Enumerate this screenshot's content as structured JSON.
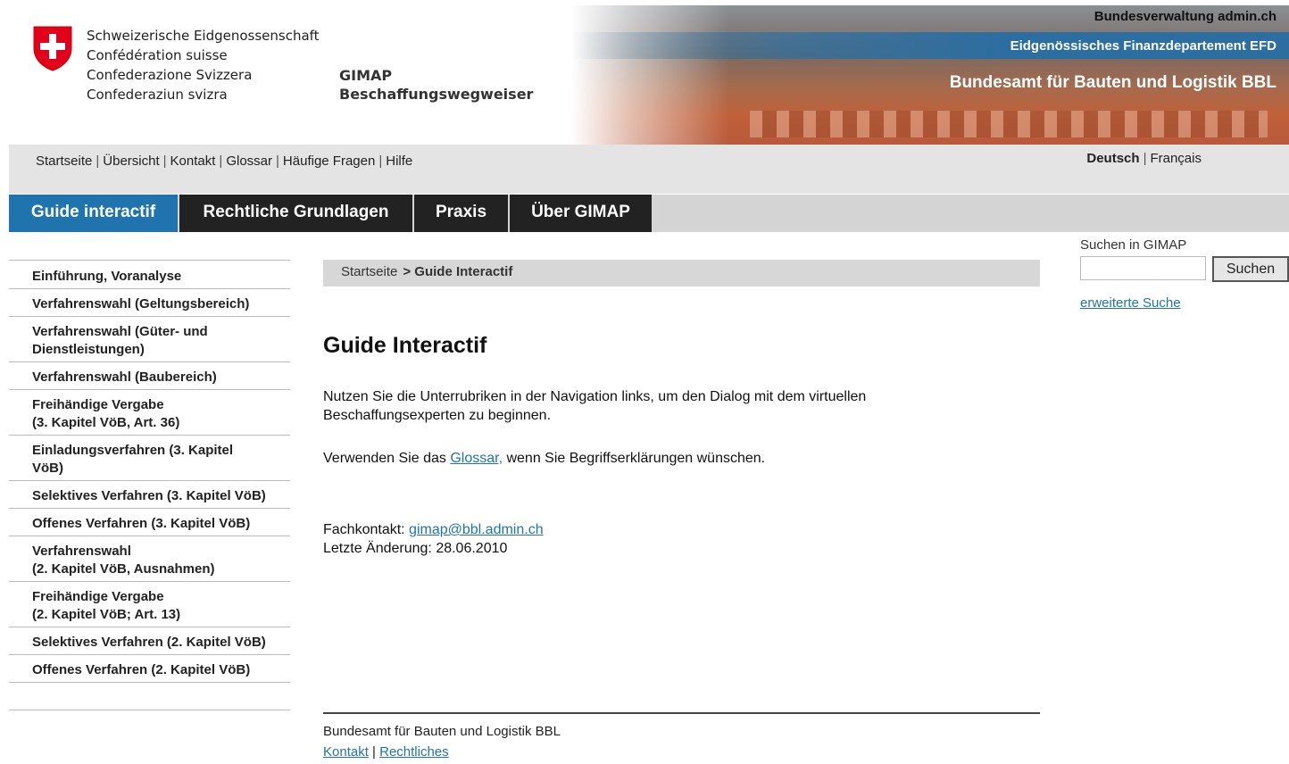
{
  "header": {
    "confederation_lines": [
      "Schweizerische Eidgenossenschaft",
      "Confédération suisse",
      "Confederazione Svizzera",
      "Confederaziun svizra"
    ],
    "app_title_line1": "GIMAP",
    "app_title_line2": "Beschaffungswegweiser",
    "banner_admin": "Bundesverwaltung admin.ch",
    "banner_efd": "Eidgenössisches Finanzdepartement EFD",
    "banner_bbl": "Bundesamt für Bauten und Logistik BBL"
  },
  "topnav": {
    "links": [
      "Startseite",
      "Übersicht",
      "Kontakt",
      "Glossar",
      "Häufige Fragen",
      "Hilfe"
    ],
    "lang_active": "Deutsch",
    "lang_other": "Français"
  },
  "mainnav": {
    "tabs": [
      "Guide interactif",
      "Rechtliche Grundlagen",
      "Praxis",
      "Über GIMAP"
    ],
    "active_color": "#1f74ad"
  },
  "sidebar": {
    "items": [
      "Einführung, Voranalyse",
      "Verfahrenswahl (Geltungsbereich)",
      "Verfahrenswahl (Güter- und Dienstleistungen)",
      "Verfahrenswahl (Baubereich)",
      "Freihändige Vergabe\n(3. Kapitel VöB, Art. 36)",
      "Einladungsverfahren (3. Kapitel VöB)",
      "Selektives Verfahren (3. Kapitel VöB)",
      "Offenes Verfahren (3. Kapitel VöB)",
      "Verfahrenswahl\n(2. Kapitel VöB, Ausnahmen)",
      "Freihändige Vergabe\n(2. Kapitel VöB; Art. 13)",
      "Selektives Verfahren (2. Kapitel VöB)",
      "Offenes Verfahren (2. Kapitel VöB)"
    ]
  },
  "breadcrumb": {
    "home": "Startseite",
    "current": "> Guide Interactif"
  },
  "content": {
    "title": "Guide Interactif",
    "para1": "Nutzen Sie die Unterrubriken in der Navigation links, um den Dialog mit dem virtuellen Beschaffungsexperten zu beginnen.",
    "para2_pre": "Verwenden Sie das ",
    "para2_link": "Glossar,",
    "para2_post": " wenn Sie Begriffserklärungen wünschen.",
    "contact_label": "Fachkontakt: ",
    "contact_email": "gimap@bbl.admin.ch",
    "last_change": "Letzte Änderung: 28.06.2010"
  },
  "footer": {
    "org": "Bundesamt für Bauten und Logistik BBL",
    "link_contact": "Kontakt",
    "link_legal": "Rechtliches"
  },
  "search": {
    "label": "Suchen in GIMAP",
    "value": "",
    "button": "Suchen",
    "advanced": "erweiterte Suche"
  }
}
